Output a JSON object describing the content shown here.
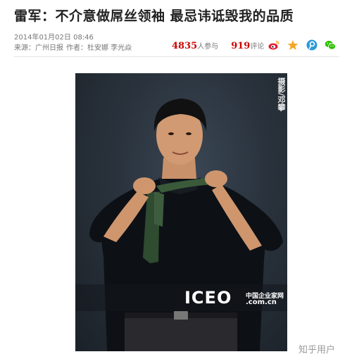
{
  "article": {
    "headline": "雷军：不介意做屌丝领袖 最忌讳诋毁我的品质",
    "date": "2014年01月02日 08:46",
    "source_label": "来源：",
    "source": "广州日报",
    "author_label": "作者：",
    "authors": "杜安娜 李光焱"
  },
  "stats": {
    "participants": "4835",
    "participants_label": "人参与",
    "comments": "919",
    "comments_label": "评论"
  },
  "share_icons": [
    "weibo-icon",
    "qzone-star-icon",
    "tencent-weibo-icon",
    "wechat-icon"
  ],
  "photo": {
    "credit": "摄影/邓攀",
    "brand_logo": "ICEO",
    "brand_cn": "中国企业家网",
    "brand_url": ".com.cn"
  },
  "watermark": "知乎用户",
  "colors": {
    "number_red": "#cc0000",
    "weibo_red": "#e6162d",
    "star_orange": "#f5a623",
    "tencent_blue": "#2b9ad6",
    "wechat_green": "#2dc100"
  }
}
